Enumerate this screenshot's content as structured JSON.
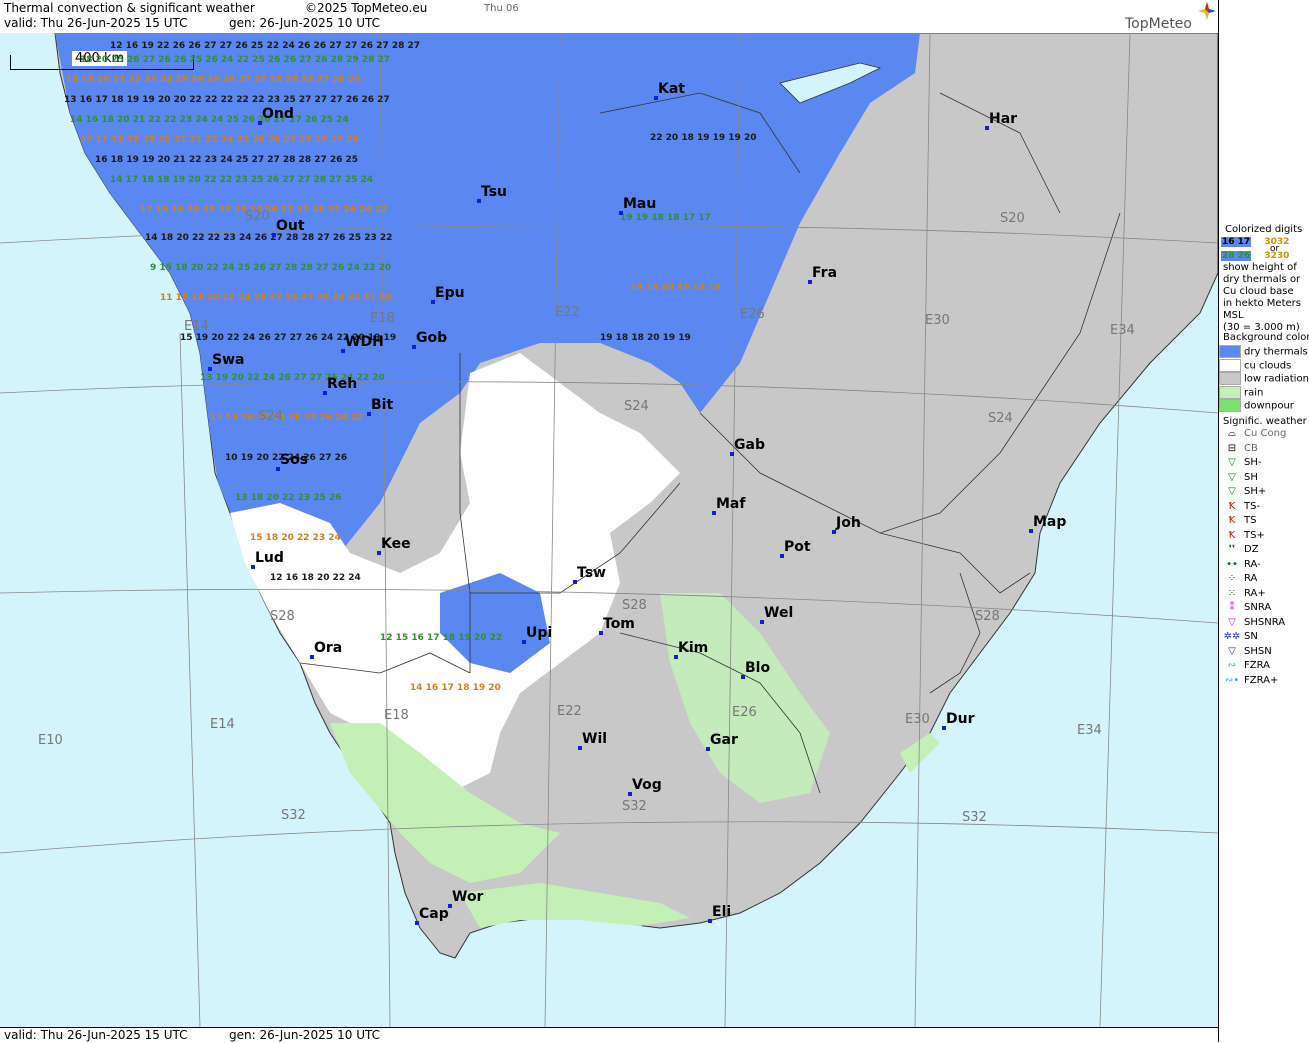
{
  "header": {
    "title": "Thermal convection & significant weather",
    "copyright": "©2025 TopMeteo.eu",
    "day_short": "Thu 06",
    "valid": "valid:  Thu   26-Jun-2025  15 UTC",
    "gen": "gen: 26-Jun-2025 10 UTC",
    "logo": "TopMeteo"
  },
  "footer": {
    "valid": "valid:  Thu   26-Jun-2025  15 UTC",
    "gen": "gen: 26-Jun-2025 10 UTC"
  },
  "scale": {
    "label": "400 km"
  },
  "cities": [
    {
      "name": "Kat"
    },
    {
      "name": "Har"
    },
    {
      "name": "Ond"
    },
    {
      "name": "Tsu"
    },
    {
      "name": "Mau"
    },
    {
      "name": "Out"
    },
    {
      "name": "Fra"
    },
    {
      "name": "Epu"
    },
    {
      "name": "WDH"
    },
    {
      "name": "Gob"
    },
    {
      "name": "Swa"
    },
    {
      "name": "Reh"
    },
    {
      "name": "Bit"
    },
    {
      "name": "Gab"
    },
    {
      "name": "Sos"
    },
    {
      "name": "Maf"
    },
    {
      "name": "Joh"
    },
    {
      "name": "Map"
    },
    {
      "name": "Kee"
    },
    {
      "name": "Pot"
    },
    {
      "name": "Lud"
    },
    {
      "name": "Tsw"
    },
    {
      "name": "Wel"
    },
    {
      "name": "Tom"
    },
    {
      "name": "Upi"
    },
    {
      "name": "Ora"
    },
    {
      "name": "Kim"
    },
    {
      "name": "Blo"
    },
    {
      "name": "Dur"
    },
    {
      "name": "Wil"
    },
    {
      "name": "Gar"
    },
    {
      "name": "Vog"
    },
    {
      "name": "Wor"
    },
    {
      "name": "Cap"
    },
    {
      "name": "Eli"
    }
  ],
  "grid_labels": [
    "S20",
    "S20",
    "E14",
    "E18",
    "E22",
    "E26",
    "E30",
    "E34",
    "S24",
    "S24",
    "S24",
    "S28",
    "S28",
    "S28",
    "E10",
    "E14",
    "E18",
    "E22",
    "E26",
    "E30",
    "E34",
    "S32",
    "S32",
    "S32"
  ],
  "legend": {
    "colorized_title": "Colorized digits",
    "sample_a": "16 17",
    "sample_b": "28 26",
    "sample_c": "3032",
    "sample_d": "3230",
    "or": "or",
    "desc": [
      "show height of",
      "dry thermals or",
      "Cu cloud base",
      "in hekto Meters",
      "MSL",
      "(30 = 3.000 m)"
    ],
    "bg_title": "Background color",
    "bg_items": [
      {
        "label": "dry thermals",
        "color": "#5b87f0"
      },
      {
        "label": "cu clouds",
        "color": "#ffffff"
      },
      {
        "label": "low radiation",
        "color": "#c8c8c8"
      },
      {
        "label": "rain",
        "color": "#c4f0b8"
      },
      {
        "label": "downpour",
        "color": "#7ae06e"
      }
    ],
    "sigwx_title": "Signific. weather",
    "sigwx_items": [
      {
        "label": "Cu Cong",
        "sym": "⌓",
        "color": "#000000"
      },
      {
        "label": "CB",
        "sym": "⊟",
        "color": "#000000"
      },
      {
        "label": "SH-",
        "sym": "▽",
        "color": "#108010"
      },
      {
        "label": "SH",
        "sym": "▽",
        "color": "#108010"
      },
      {
        "label": "SH+",
        "sym": "▽",
        "color": "#108010"
      },
      {
        "label": "TS-",
        "sym": "Ꝁ",
        "color": "#d01010"
      },
      {
        "label": "TS",
        "sym": "Ꝁ",
        "color": "#d01010"
      },
      {
        "label": "TS+",
        "sym": "Ꝁ",
        "color": "#d01010"
      },
      {
        "label": "DZ",
        "sym": "❜❜",
        "color": "#106010"
      },
      {
        "label": "RA-",
        "sym": "••",
        "color": "#106010"
      },
      {
        "label": "RA",
        "sym": "⁘",
        "color": "#106010"
      },
      {
        "label": "RA+",
        "sym": "⁙",
        "color": "#106010"
      },
      {
        "label": "SNRA",
        "sym": "⁑",
        "color": "#c020c0"
      },
      {
        "label": "SHSNRA",
        "sym": "▽",
        "color": "#c020c0"
      },
      {
        "label": "SN",
        "sym": "✲✲",
        "color": "#2030d0"
      },
      {
        "label": "SHSN",
        "sym": "▽",
        "color": "#2030d0"
      },
      {
        "label": "FZRA",
        "sym": "∾",
        "color": "#20b0d0"
      },
      {
        "label": "FZRA+",
        "sym": "∾•",
        "color": "#20b0d0"
      }
    ]
  }
}
